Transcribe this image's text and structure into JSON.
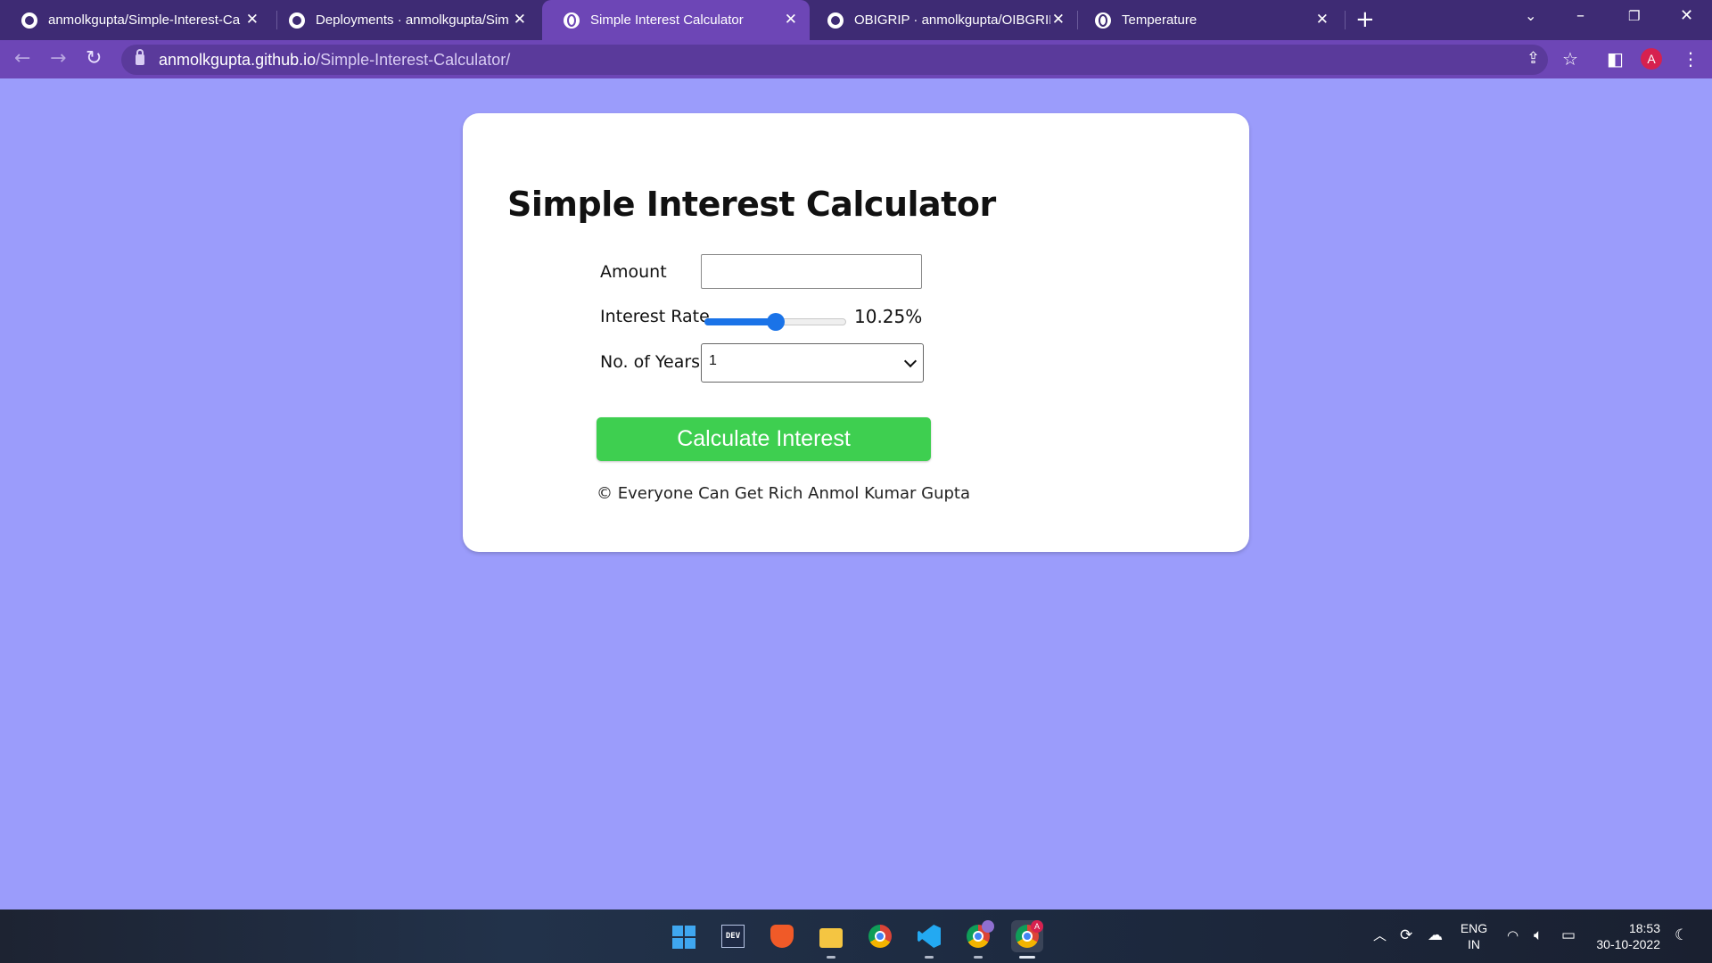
{
  "browser": {
    "tabs": [
      {
        "title": "anmolkgupta/Simple-Interest-Ca",
        "icon": "github-icon",
        "active": false
      },
      {
        "title": "Deployments · anmolkgupta/Sim",
        "icon": "github-icon",
        "active": false
      },
      {
        "title": "Simple Interest Calculator",
        "icon": "globe-icon",
        "active": true
      },
      {
        "title": "OBIGRIP · anmolkgupta/OIBGRIP",
        "icon": "github-icon",
        "active": false
      },
      {
        "title": "Temperature",
        "icon": "globe-icon",
        "active": false
      }
    ],
    "new_tab_symbol": "+",
    "url_domain": "anmolkgupta.github.io",
    "url_path": "/Simple-Interest-Calculator/",
    "profile_initial": "A",
    "colors": {
      "tabstrip": "#3e2b74",
      "active_tab": "#6d46b6",
      "toolbar": "#6d46b6",
      "profile": "#d6214f"
    }
  },
  "page": {
    "background": "#9b9cfb",
    "title": "Simple Interest Calculator",
    "form": {
      "amount_label": "Amount",
      "amount_value": "",
      "rate_label": "Interest Rate",
      "rate_value": "10.25%",
      "rate_fraction": 0.5,
      "years_label": "No. of Years",
      "years_selected": "1",
      "button_label": "Calculate Interest",
      "button_color": "#3ecf50"
    },
    "footer": "© Everyone Can Get Rich Anmol Kumar Gupta"
  },
  "taskbar": {
    "apps": [
      {
        "name": "start-icon"
      },
      {
        "name": "dev-home-icon",
        "label": "DEV"
      },
      {
        "name": "brave-icon"
      },
      {
        "name": "file-explorer-icon"
      },
      {
        "name": "chrome-icon"
      },
      {
        "name": "vscode-icon"
      },
      {
        "name": "chrome-profile-icon"
      },
      {
        "name": "chrome-active-icon",
        "badge": "A"
      }
    ],
    "language_line1": "ENG",
    "language_line2": "IN",
    "time": "18:53",
    "date": "30-10-2022"
  }
}
